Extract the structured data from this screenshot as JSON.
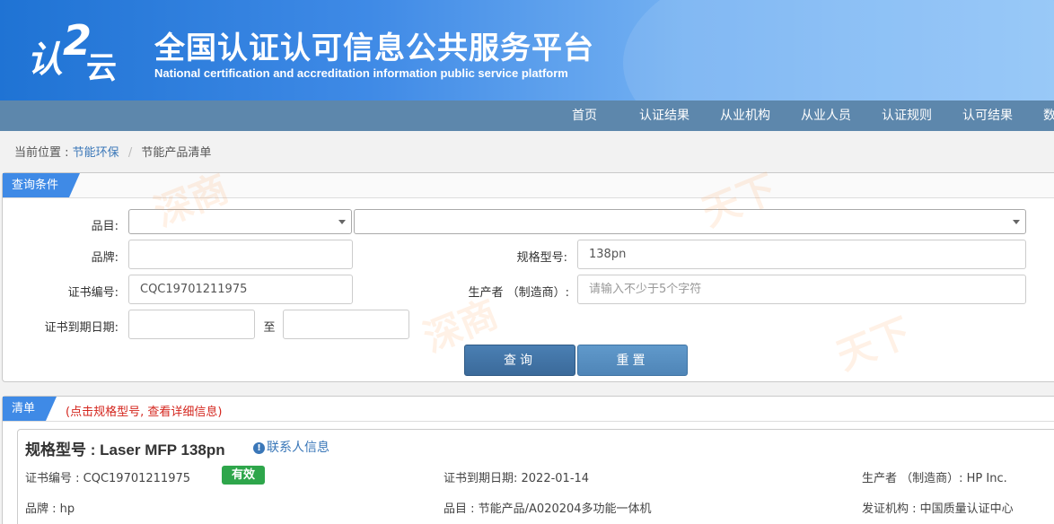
{
  "header": {
    "logo_chars": [
      "认",
      "2",
      "云"
    ],
    "title": "全国认证认可信息公共服务平台",
    "subtitle": "National certification and accreditation information public service platform"
  },
  "nav": {
    "items": [
      "首页",
      "认证结果",
      "从业机构",
      "从业人员",
      "认证规则",
      "认可结果",
      "数"
    ]
  },
  "breadcrumb": {
    "prefix": "当前位置 :",
    "link": "节能环保",
    "separator": "/",
    "current": "节能产品清单"
  },
  "query": {
    "tag": "查询条件",
    "category_label": "品目:",
    "brand_label": "品牌:",
    "brand_value": "",
    "model_label": "规格型号:",
    "model_value": "138pn",
    "cert_no_label": "证书编号:",
    "cert_no_value": "CQC19701211975",
    "producer_label": "生产者 （制造商）:",
    "producer_placeholder": "请输入不少于5个字符",
    "expiry_label": "证书到期日期:",
    "expiry_to": "至",
    "query_button": "查询",
    "reset_button": "重置"
  },
  "list": {
    "tag": "清单",
    "hint": "(点击规格型号, 查看详细信息)",
    "items": [
      {
        "model": "规格型号 : Laser MFP 138pn",
        "contact": "联系人信息",
        "cert_no": "证书编号 : CQC19701211975",
        "status": "有效",
        "expiry": "证书到期日期: 2022-01-14",
        "producer": "生产者 （制造商）: HP Inc.",
        "brand": "品牌 : hp",
        "category": "品目 : 节能产品/A020204多功能一体机",
        "issuer": "发证机构 : 中国质量认证中心"
      }
    ]
  },
  "watermark": [
    "深商",
    "天下"
  ],
  "colors": {
    "header_blue": "#3f8ae6",
    "nav_bg": "#5d87ac",
    "status_green": "#2ea64b",
    "hint_red": "#d4261e",
    "link_blue": "#3a77b8"
  }
}
